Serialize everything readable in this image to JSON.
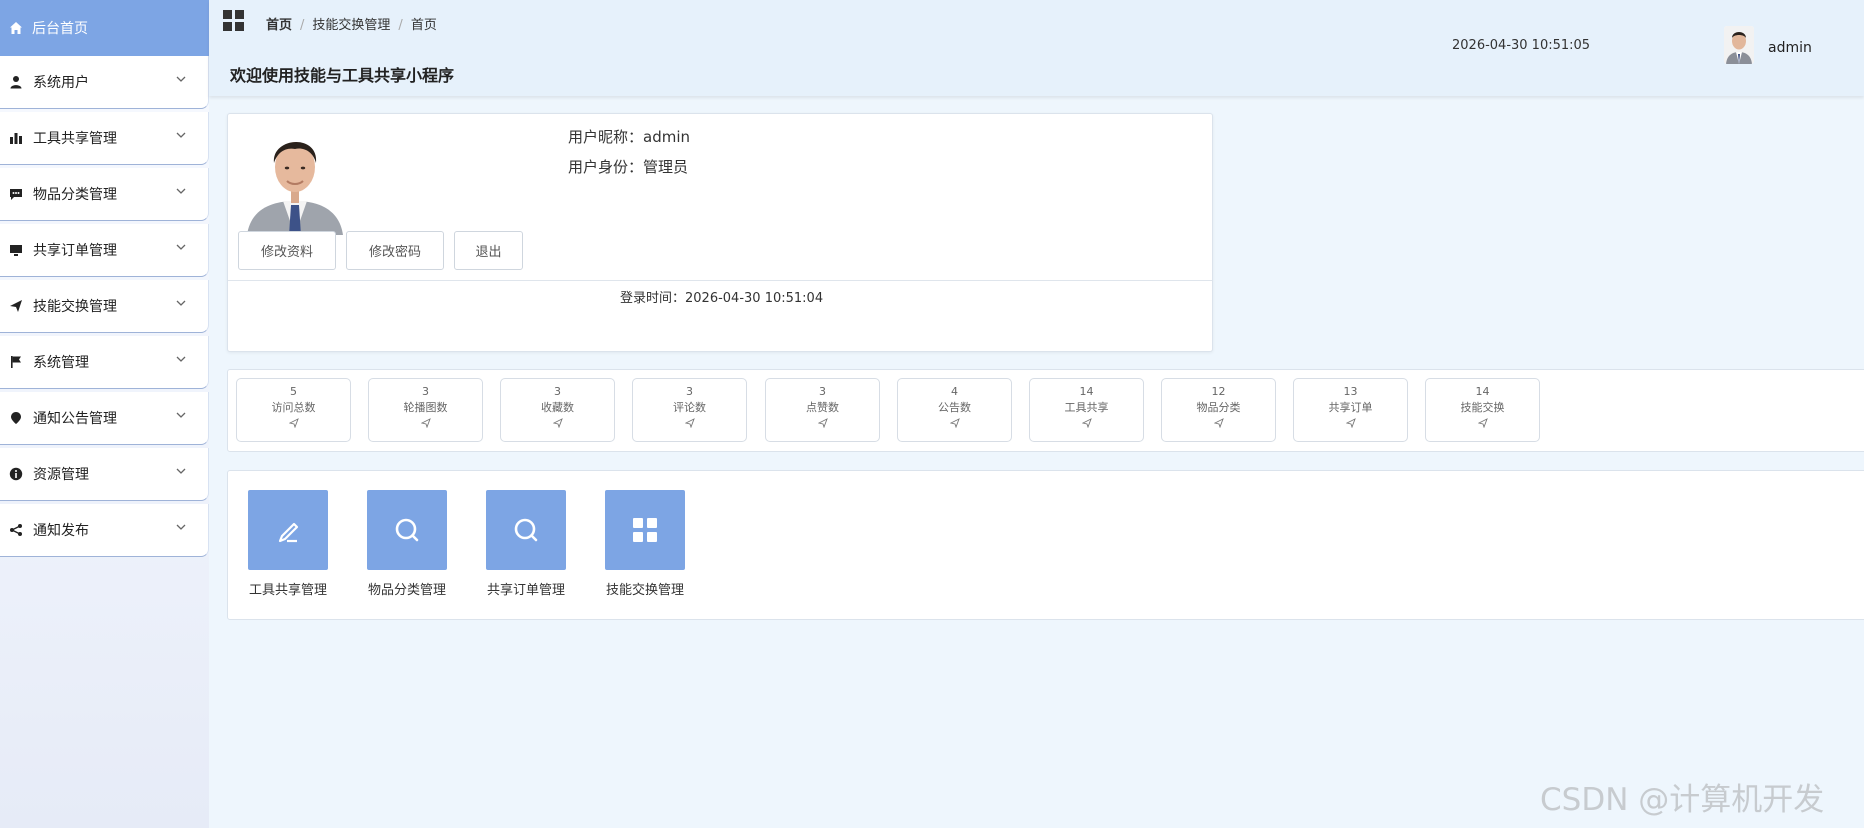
{
  "sidebar": {
    "home": {
      "label": "后台首页",
      "icon": "home-icon"
    },
    "items": [
      {
        "label": "系统用户",
        "icon": "user-icon"
      },
      {
        "label": "工具共享管理",
        "icon": "bar-chart-icon"
      },
      {
        "label": "物品分类管理",
        "icon": "chat-icon"
      },
      {
        "label": "共享订单管理",
        "icon": "monitor-icon"
      },
      {
        "label": "技能交换管理",
        "icon": "send-icon"
      },
      {
        "label": "系统管理",
        "icon": "flag-icon"
      },
      {
        "label": "通知公告管理",
        "icon": "location-icon"
      },
      {
        "label": "资源管理",
        "icon": "info-icon"
      },
      {
        "label": "通知发布",
        "icon": "share-icon"
      }
    ]
  },
  "header": {
    "breadcrumb": [
      "首页",
      "技能交换管理",
      "首页"
    ],
    "title": "欢迎使用技能与工具共享小程序",
    "datetime": "2026-04-30 10:51:05",
    "username": "admin"
  },
  "profile": {
    "nickname_label": "用户昵称：",
    "nickname": "admin",
    "role_label": "用户身份：",
    "role": "管理员",
    "buttons": {
      "edit_profile": "修改资料",
      "change_password": "修改密码",
      "logout": "退出"
    },
    "login_time_label": "登录时间：",
    "login_time": "2026-04-30 10:51:04"
  },
  "stats": [
    {
      "value": "5",
      "label": "访问总数"
    },
    {
      "value": "3",
      "label": "轮播图数"
    },
    {
      "value": "3",
      "label": "收藏数"
    },
    {
      "value": "3",
      "label": "评论数"
    },
    {
      "value": "3",
      "label": "点赞数"
    },
    {
      "value": "4",
      "label": "公告数"
    },
    {
      "value": "14",
      "label": "工具共享"
    },
    {
      "value": "12",
      "label": "物品分类"
    },
    {
      "value": "13",
      "label": "共享订单"
    },
    {
      "value": "14",
      "label": "技能交换"
    }
  ],
  "quick_links": [
    {
      "label": "工具共享管理",
      "icon": "edit-icon"
    },
    {
      "label": "物品分类管理",
      "icon": "search-icon"
    },
    {
      "label": "共享订单管理",
      "icon": "search-icon"
    },
    {
      "label": "技能交换管理",
      "icon": "grid-icon"
    }
  ],
  "watermark": "CSDN @计算机开发",
  "colors": {
    "accent": "#7da5e4",
    "background": "#eef6fd",
    "header": "#e6f1fb"
  }
}
